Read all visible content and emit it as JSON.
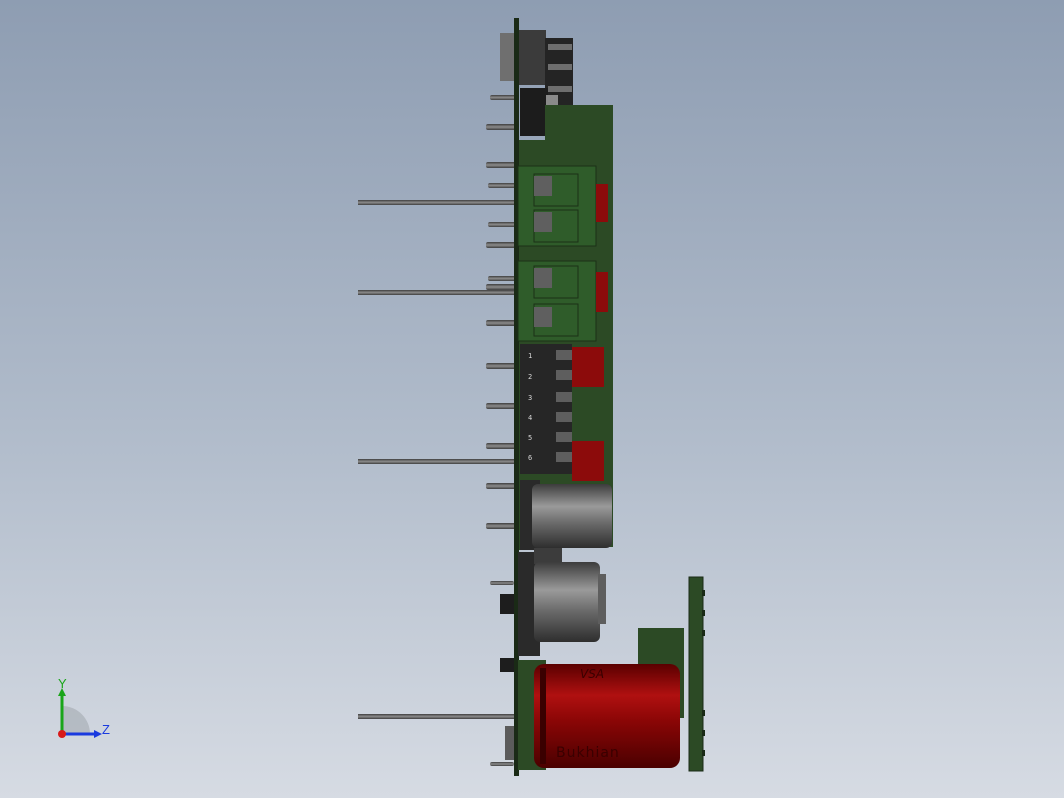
{
  "viewport": {
    "background_top": "#8e9db2",
    "background_bottom": "#d6dbe3"
  },
  "triad": {
    "y_label": "Y",
    "z_label": "Z",
    "y_color": "#1aa51a",
    "z_color": "#1a3adf",
    "origin_color": "#d81a1a"
  },
  "board": {
    "pcb_color": "#2c4a25",
    "edge_color": "#1a2a16",
    "red_color": "#8c0b0b",
    "connector_color": "#262626"
  },
  "connector_pin_numbers": [
    "1",
    "2",
    "3",
    "4",
    "5",
    "6"
  ],
  "capacitor_label": {
    "top_text": "VSA",
    "side_text": "Bukhian"
  }
}
